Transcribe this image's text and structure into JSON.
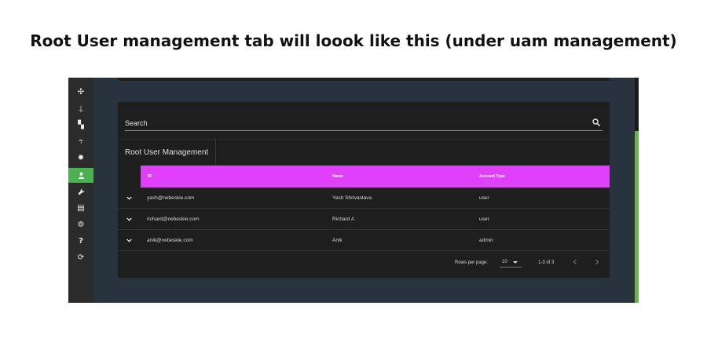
{
  "caption": "Root User management tab will loook like this (under uam management)",
  "sidebar": {
    "items": [
      {
        "icon": "fan-icon",
        "glyph": "✣"
      },
      {
        "icon": "tower-icon",
        "glyph": "⍊"
      },
      {
        "icon": "dashboard-icon",
        "glyph": "▚"
      },
      {
        "icon": "route-icon",
        "glyph": "⥾"
      },
      {
        "icon": "bulb-icon",
        "glyph": "✹"
      },
      {
        "icon": "user-icon",
        "glyph": "👤",
        "active": true
      },
      {
        "icon": "wrench-icon",
        "glyph": "🔧"
      },
      {
        "icon": "log-icon",
        "glyph": "▤"
      },
      {
        "icon": "gear-icon",
        "glyph": "⚙"
      },
      {
        "icon": "help-icon",
        "glyph": "?"
      },
      {
        "icon": "sync-icon",
        "glyph": "⟳"
      }
    ]
  },
  "search": {
    "placeholder": "Search"
  },
  "panel": {
    "title": "Root User Management"
  },
  "table": {
    "columns": [
      "ID",
      "Name",
      "Account Type"
    ],
    "rows": [
      {
        "id": "yash@nebeskie.com",
        "name": "Yash Shrivastava",
        "type": "user"
      },
      {
        "id": "richard@nebeskie.com",
        "name": "Richard A",
        "type": "user"
      },
      {
        "id": "anik@nebeskie.com",
        "name": "Anik",
        "type": "admin"
      }
    ]
  },
  "pagination": {
    "rows_per_page_label": "Rows per page:",
    "rows_per_page_value": "10",
    "range": "1-3 of 3"
  },
  "colors": {
    "header_accent": "#e040fb",
    "active_nav": "#4caf50",
    "panel_bg": "#1e1e1e",
    "page_bg": "#28333d"
  }
}
